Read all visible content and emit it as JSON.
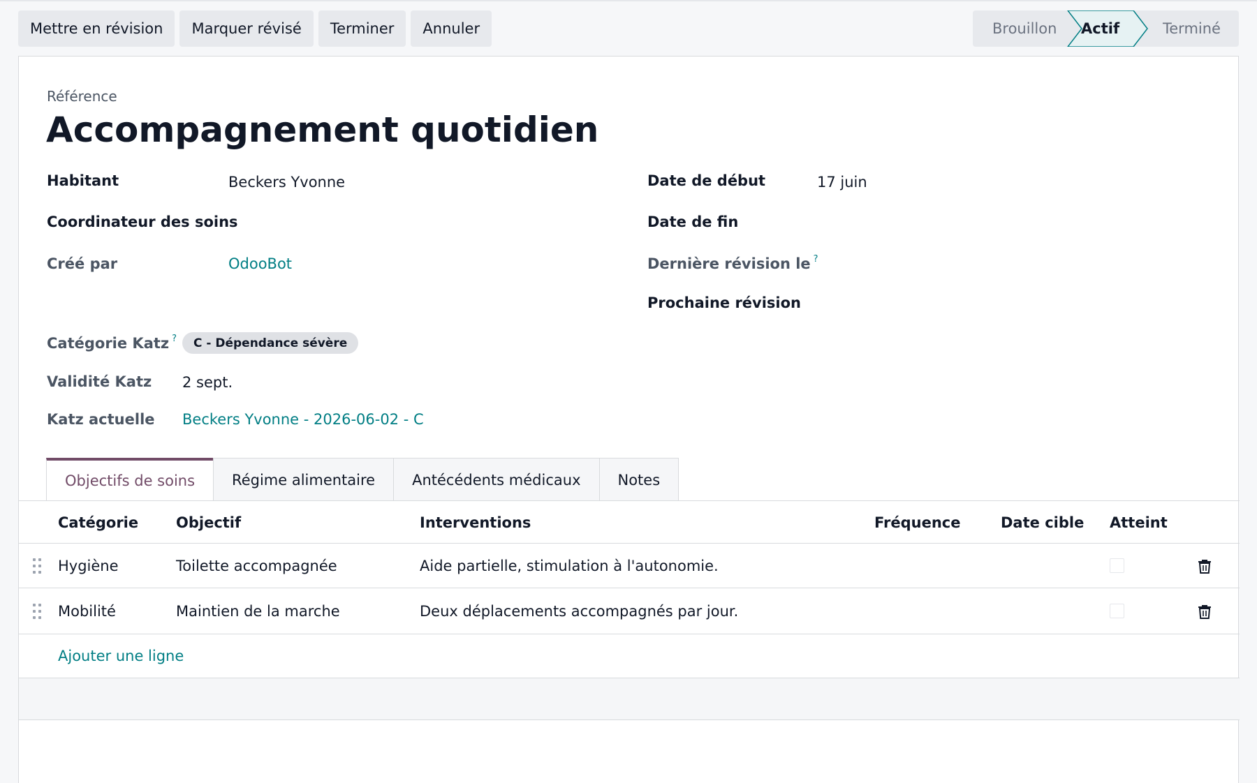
{
  "toolbar": {
    "buttons": [
      "Mettre en révision",
      "Marquer révisé",
      "Terminer",
      "Annuler"
    ]
  },
  "status": {
    "stages": [
      "Brouillon",
      "Actif",
      "Terminé"
    ],
    "current": "Actif"
  },
  "form": {
    "ref_label": "Référence",
    "title": "Accompagnement quotidien",
    "fields": {
      "habitant": {
        "label": "Habitant",
        "value": "Beckers Yvonne"
      },
      "coordinateur": {
        "label": "Coordinateur des soins",
        "value": ""
      },
      "cree_par": {
        "label": "Créé par",
        "value": "OdooBot"
      },
      "date_debut": {
        "label": "Date de début",
        "value": "17 juin"
      },
      "date_fin": {
        "label": "Date de fin",
        "value": ""
      },
      "derniere_revision": {
        "label": "Dernière révision le",
        "help": "?",
        "value": ""
      },
      "prochaine_revision": {
        "label": "Prochaine révision",
        "value": ""
      },
      "categorie_katz": {
        "label": "Catégorie Katz",
        "help": "?",
        "value": "C - Dépendance sévère"
      },
      "validite_katz": {
        "label": "Validité Katz",
        "value": "2 sept."
      },
      "katz_actuelle": {
        "label": "Katz actuelle",
        "value": "Beckers Yvonne - 2026-06-02 - C"
      }
    }
  },
  "tabs": [
    "Objectifs de soins",
    "Régime alimentaire",
    "Antécédents médicaux",
    "Notes"
  ],
  "active_tab": "Objectifs de soins",
  "table": {
    "columns": [
      "Catégorie",
      "Objectif",
      "Interventions",
      "Fréquence",
      "Date cible",
      "Atteint"
    ],
    "rows": [
      {
        "categorie": "Hygiène",
        "objectif": "Toilette accompagnée",
        "interventions": "Aide partielle, stimulation à l'autonomie.",
        "frequence": "",
        "date_cible": "",
        "atteint": false
      },
      {
        "categorie": "Mobilité",
        "objectif": "Maintien de la marche",
        "interventions": "Deux déplacements accompagnés par jour.",
        "frequence": "",
        "date_cible": "",
        "atteint": false
      }
    ],
    "add_line": "Ajouter une ligne"
  },
  "colors": {
    "accent": "#714b67",
    "link": "#017e84",
    "button_bg": "#e7e9ed"
  }
}
